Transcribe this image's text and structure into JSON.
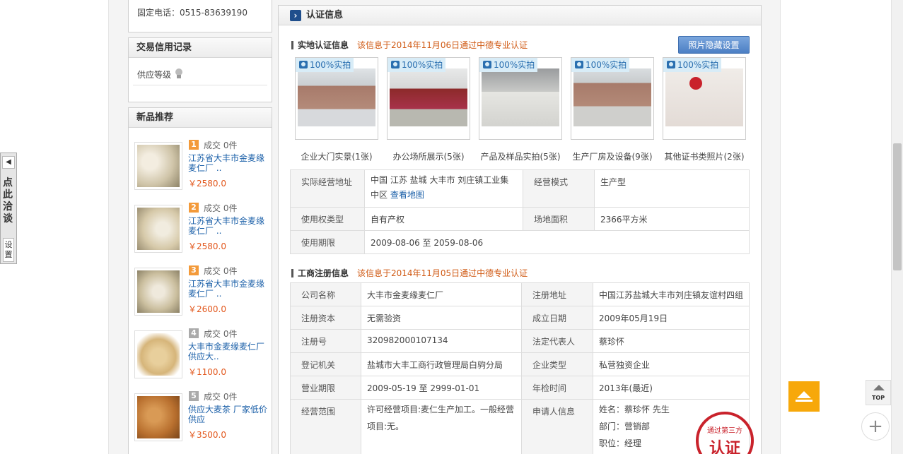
{
  "contact": {
    "phone": "固定电话：0515-83639190"
  },
  "credit": {
    "title": "交易信用记录",
    "supply_level_label": "供应等级"
  },
  "new_products": {
    "title": "新品推荐",
    "items": [
      {
        "rank": "1",
        "deal": "成交 0件",
        "name": "江苏省大丰市金麦缘麦仁厂 ..",
        "price": "￥2580.0"
      },
      {
        "rank": "2",
        "deal": "成交 0件",
        "name": "江苏省大丰市金麦缘麦仁厂 ..",
        "price": "￥2580.0"
      },
      {
        "rank": "3",
        "deal": "成交 0件",
        "name": "江苏省大丰市金麦缘麦仁厂 ..",
        "price": "￥2600.0"
      },
      {
        "rank": "4",
        "deal": "成交 0件",
        "name": "大丰市金麦缘麦仁厂 供应大..",
        "price": "￥1100.0"
      },
      {
        "rank": "5",
        "deal": "成交 0件",
        "name": "供应大麦茶 厂家低价供应",
        "price": "￥3500.0"
      }
    ]
  },
  "main": {
    "title": "认证信息",
    "site": {
      "title": "实地认证信息",
      "note": "该信息于2014年11月06日通过中德专业认证",
      "hide_button": "照片隐藏设置",
      "photo_tag": "100%实拍",
      "photos": [
        {
          "caption": "企业大门实景(1张)"
        },
        {
          "caption": "办公场所展示(5张)"
        },
        {
          "caption": "产品及样品实拍(5张)"
        },
        {
          "caption": "生产厂房及设备(9张)"
        },
        {
          "caption": "其他证书类照片(2张)"
        }
      ],
      "table": {
        "addr_label": "实际经营地址",
        "addr_value": "中国 江苏 盐城 大丰市 刘庄镇工业集中区",
        "map_link": "查看地图",
        "mode_label": "经营模式",
        "mode_value": "生产型",
        "right_label": "使用权类型",
        "right_value": "自有产权",
        "area_label": "场地面积",
        "area_value": "2366平方米",
        "period_label": "使用期限",
        "period_value": "2009-08-06 至 2059-08-06"
      }
    },
    "biz": {
      "title": "工商注册信息",
      "note": "该信息于2014年11月05日通过中德专业认证",
      "rows": [
        {
          "l1": "公司名称",
          "v1": "大丰市金麦缘麦仁厂",
          "l2": "注册地址",
          "v2": "中国江苏盐城大丰市刘庄镇友谊村四组"
        },
        {
          "l1": "注册资本",
          "v1": "无需验资",
          "l2": "成立日期",
          "v2": "2009年05月19日"
        },
        {
          "l1": "注册号",
          "v1": "320982000107134",
          "l2": "法定代表人",
          "v2": "蔡珍怀"
        },
        {
          "l1": "登记机关",
          "v1": "盐城市大丰工商行政管理局白驹分局",
          "l2": "企业类型",
          "v2": "私营独资企业"
        },
        {
          "l1": "营业期限",
          "v1": "2009-05-19  至  2999-01-01",
          "l2": "年检时间",
          "v2": "2013年(最近)"
        }
      ],
      "scope_label": "经营范围",
      "scope_value": "许可经营项目:麦仁生产加工。一般经营项目:无。",
      "applicant_label": "申请人信息",
      "applicant_name": "姓名：蔡珍怀 先生",
      "applicant_dept": "部门：营销部",
      "applicant_title": "职位：经理",
      "stamp_top": "通过第三方",
      "stamp_main": "认证"
    }
  },
  "side": {
    "chat_text": "点此洽谈",
    "settings_text": "设置",
    "top_label": "TOP",
    "arrow_left": "◀"
  }
}
